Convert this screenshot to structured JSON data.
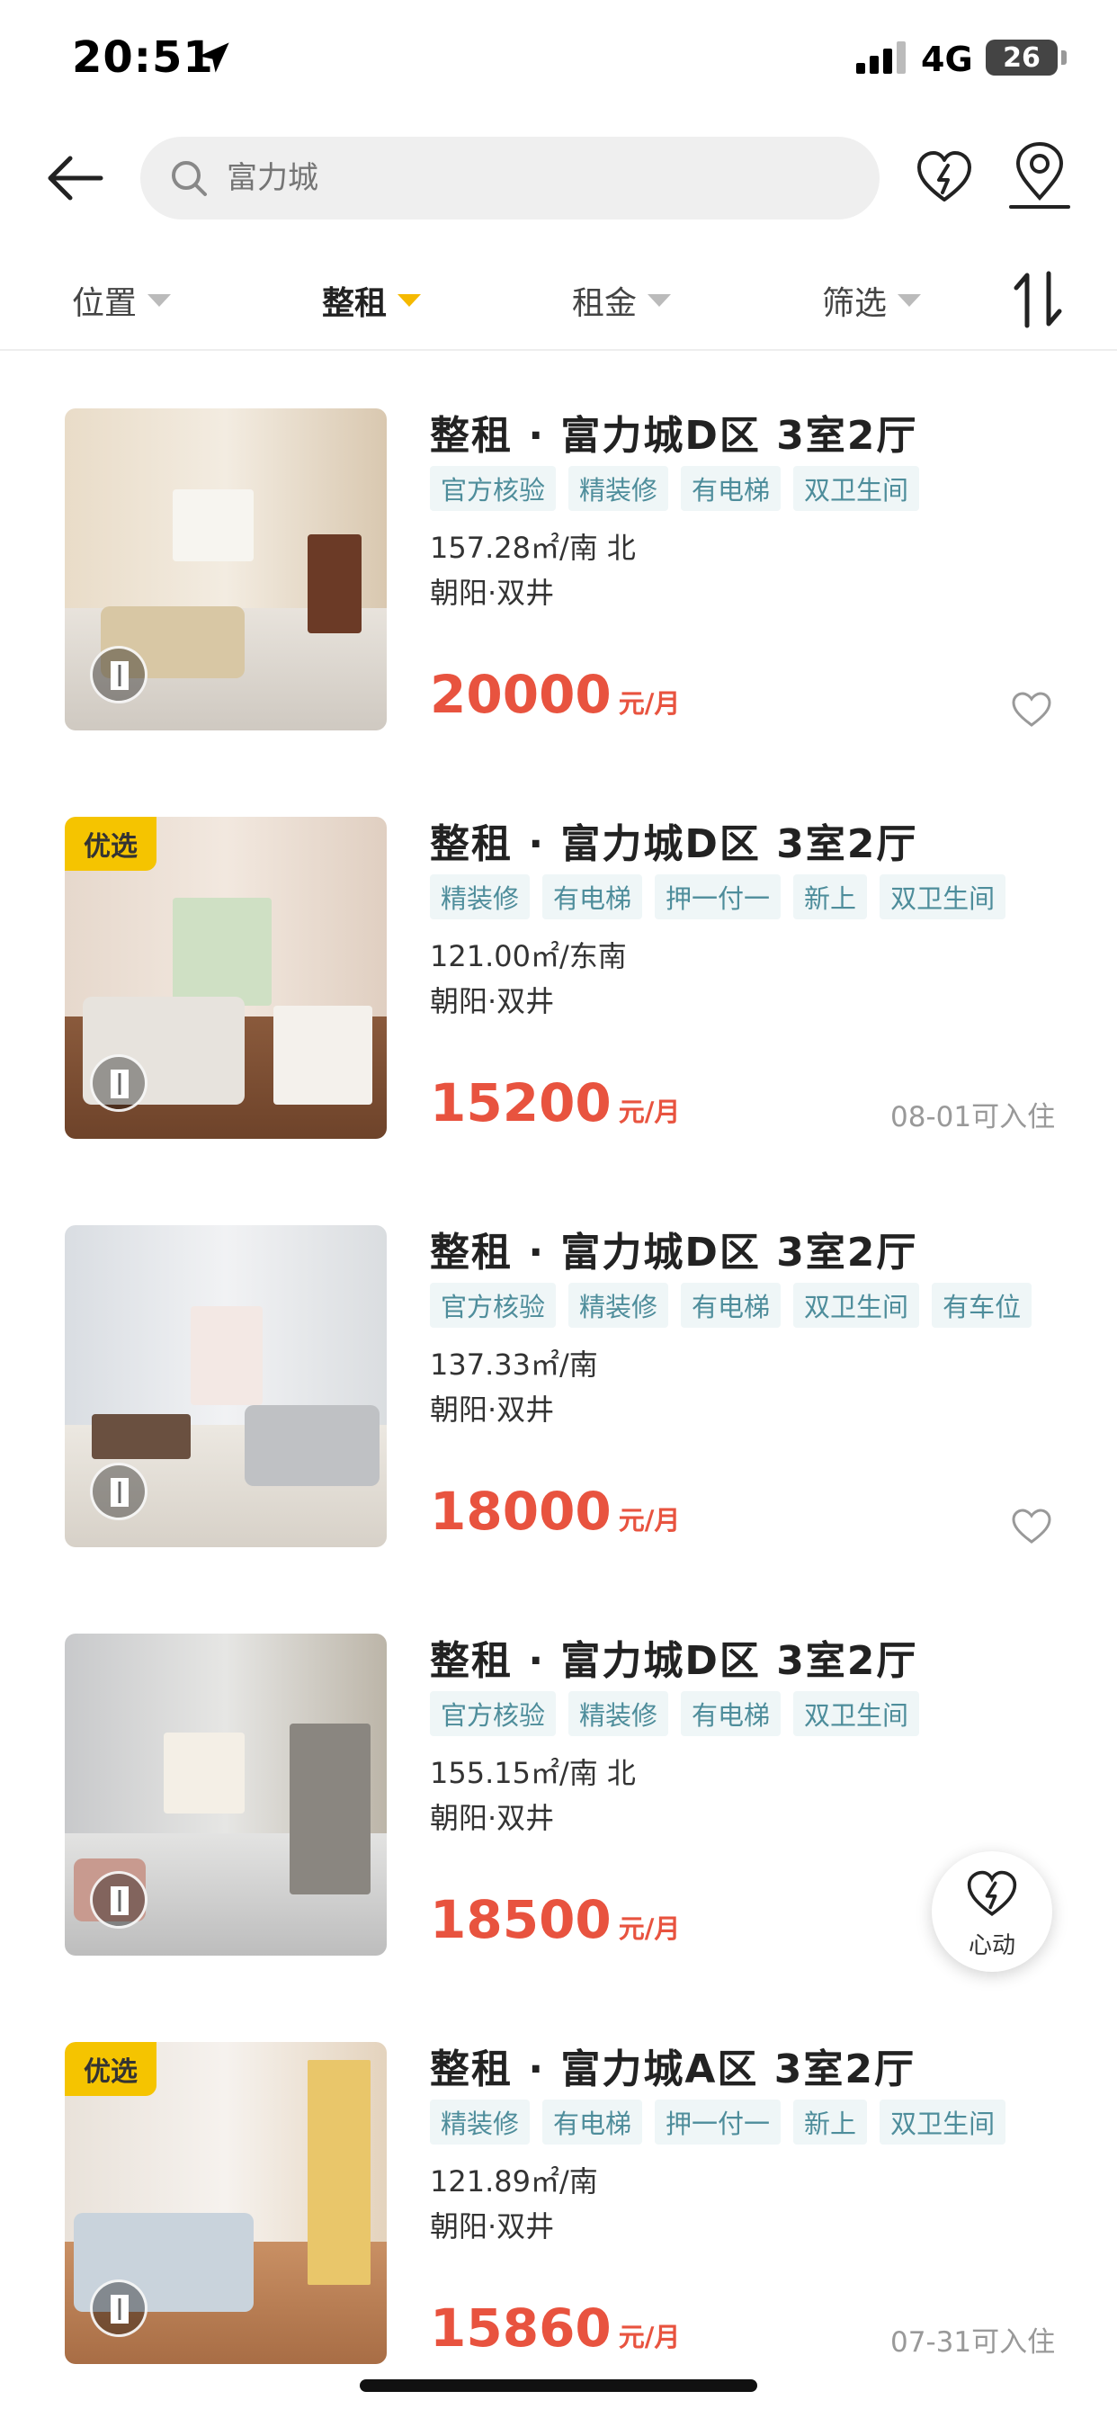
{
  "status_bar": {
    "time": "20:51",
    "network": "4G",
    "battery": "26"
  },
  "search": {
    "placeholder": "富力城"
  },
  "filters": [
    {
      "label": "位置",
      "active": false
    },
    {
      "label": "整租",
      "active": true
    },
    {
      "label": "租金",
      "active": false
    },
    {
      "label": "筛选",
      "active": false
    }
  ],
  "listings": [
    {
      "title": "整租 · 富力城D区 3室2厅",
      "tags": [
        "官方核验",
        "精装修",
        "有电梯",
        "双卫生间"
      ],
      "area": "157.28㎡/南 北",
      "district": "朝阳·双井",
      "price": "20000",
      "unit": "元/月",
      "badge": "",
      "available": ""
    },
    {
      "title": "整租 · 富力城D区 3室2厅",
      "tags": [
        "精装修",
        "有电梯",
        "押一付一",
        "新上",
        "双卫生间"
      ],
      "area": "121.00㎡/东南",
      "district": "朝阳·双井",
      "price": "15200",
      "unit": "元/月",
      "badge": "优选",
      "available": "08-01可入住"
    },
    {
      "title": "整租 · 富力城D区 3室2厅",
      "tags": [
        "官方核验",
        "精装修",
        "有电梯",
        "双卫生间",
        "有车位"
      ],
      "area": "137.33㎡/南",
      "district": "朝阳·双井",
      "price": "18000",
      "unit": "元/月",
      "badge": "",
      "available": ""
    },
    {
      "title": "整租 · 富力城D区 3室2厅",
      "tags": [
        "官方核验",
        "精装修",
        "有电梯",
        "双卫生间"
      ],
      "area": "155.15㎡/南 北",
      "district": "朝阳·双井",
      "price": "18500",
      "unit": "元/月",
      "badge": "",
      "available": ""
    },
    {
      "title": "整租 · 富力城A区 3室2厅",
      "tags": [
        "精装修",
        "有电梯",
        "押一付一",
        "新上",
        "双卫生间"
      ],
      "area": "121.89㎡/南",
      "district": "朝阳·双井",
      "price": "15860",
      "unit": "元/月",
      "badge": "优选",
      "available": "07-31可入住"
    }
  ],
  "floating": {
    "label": "心动"
  },
  "icons": {
    "back": "arrow-left-icon",
    "search": "search-icon",
    "heart_flash": "heart-lightning-icon",
    "location": "location-pin-icon",
    "sort": "sort-icon",
    "favorite": "heart-outline-icon",
    "vr": "vr-door-icon"
  },
  "colors": {
    "price": "#e8533f",
    "tag_text": "#4e8d9b",
    "tag_bg": "#eff6f7",
    "badge": "#f5c400",
    "active_caret": "#f5b900"
  }
}
